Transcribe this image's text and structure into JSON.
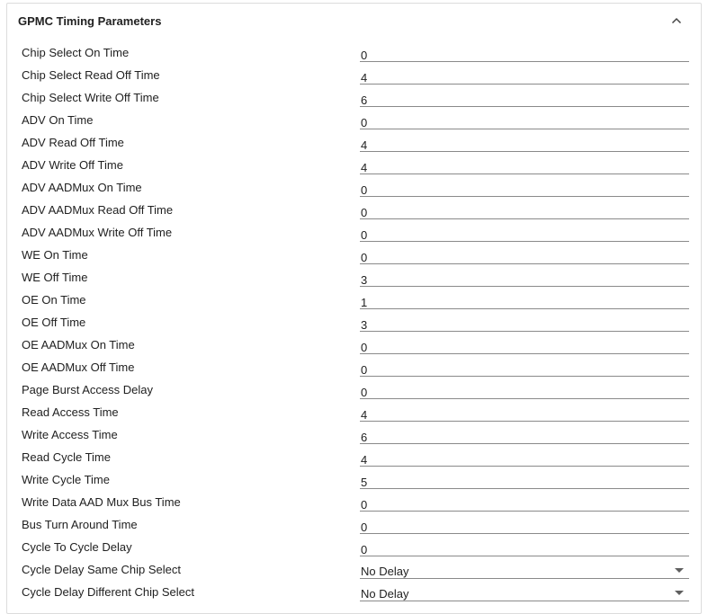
{
  "panel": {
    "title": "GPMC Timing Parameters",
    "collapse_icon": "chevron-up-icon"
  },
  "params": [
    {
      "label": "Chip Select On Time",
      "value": "0"
    },
    {
      "label": "Chip Select Read Off Time",
      "value": "4"
    },
    {
      "label": "Chip Select Write Off Time",
      "value": "6"
    },
    {
      "label": "ADV On Time",
      "value": "0"
    },
    {
      "label": "ADV Read Off Time",
      "value": "4"
    },
    {
      "label": "ADV Write Off Time",
      "value": "4"
    },
    {
      "label": "ADV AADMux On Time",
      "value": "0"
    },
    {
      "label": "ADV AADMux Read Off Time",
      "value": "0"
    },
    {
      "label": "ADV AADMux Write Off Time",
      "value": "0"
    },
    {
      "label": "WE On Time",
      "value": "0"
    },
    {
      "label": "WE Off Time",
      "value": "3"
    },
    {
      "label": "OE On Time",
      "value": "1"
    },
    {
      "label": "OE Off Time",
      "value": "3"
    },
    {
      "label": "OE AADMux On Time",
      "value": "0"
    },
    {
      "label": "OE AADMux Off Time",
      "value": "0"
    },
    {
      "label": "Page Burst Access Delay",
      "value": "0"
    },
    {
      "label": "Read Access Time",
      "value": "4"
    },
    {
      "label": "Write Access Time",
      "value": "6"
    },
    {
      "label": "Read Cycle Time",
      "value": "4"
    },
    {
      "label": "Write Cycle Time",
      "value": "5"
    },
    {
      "label": "Write Data AAD Mux Bus Time",
      "value": "0"
    },
    {
      "label": "Bus Turn Around Time",
      "value": "0"
    },
    {
      "label": "Cycle To Cycle Delay",
      "value": "0"
    }
  ],
  "selects": [
    {
      "label": "Cycle Delay Same Chip Select",
      "value": "No Delay",
      "icon": "dropdown-arrow-icon"
    },
    {
      "label": "Cycle Delay Different Chip Select",
      "value": "No Delay",
      "icon": "dropdown-arrow-icon"
    }
  ]
}
